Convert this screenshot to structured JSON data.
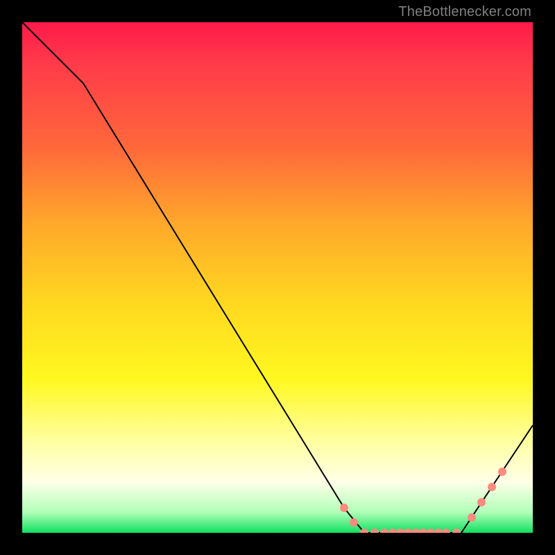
{
  "watermark": "TheBottlenecker.com",
  "chart_data": {
    "type": "line",
    "title": "",
    "xlabel": "",
    "ylabel": "",
    "ylim": [
      0,
      100
    ],
    "xlim": [
      0,
      100
    ],
    "grid": false,
    "series": [
      {
        "name": "curve",
        "x": [
          0,
          12,
          63,
          67,
          86,
          100
        ],
        "y": [
          100,
          88,
          5,
          0,
          0,
          21
        ]
      }
    ],
    "markers": {
      "name": "highlight-dots",
      "points": [
        {
          "x": 63,
          "y": 5
        },
        {
          "x": 65,
          "y": 2
        },
        {
          "x": 67,
          "y": 0
        },
        {
          "x": 69,
          "y": 0
        },
        {
          "x": 71,
          "y": 0
        },
        {
          "x": 72.5,
          "y": 0
        },
        {
          "x": 74,
          "y": 0
        },
        {
          "x": 75.5,
          "y": 0
        },
        {
          "x": 77,
          "y": 0
        },
        {
          "x": 78.5,
          "y": 0
        },
        {
          "x": 80,
          "y": 0
        },
        {
          "x": 81.5,
          "y": 0
        },
        {
          "x": 83,
          "y": 0
        },
        {
          "x": 85,
          "y": 0
        },
        {
          "x": 88,
          "y": 3
        },
        {
          "x": 90,
          "y": 6
        },
        {
          "x": 92,
          "y": 9
        },
        {
          "x": 94,
          "y": 12
        }
      ]
    },
    "background_gradient": {
      "stops": [
        {
          "pos": 0,
          "color": "#ff1a4a"
        },
        {
          "pos": 25,
          "color": "#ff6a3a"
        },
        {
          "pos": 55,
          "color": "#ffd820"
        },
        {
          "pos": 82,
          "color": "#ffffa0"
        },
        {
          "pos": 96,
          "color": "#b0ffb8"
        },
        {
          "pos": 100,
          "color": "#10e060"
        }
      ]
    }
  }
}
